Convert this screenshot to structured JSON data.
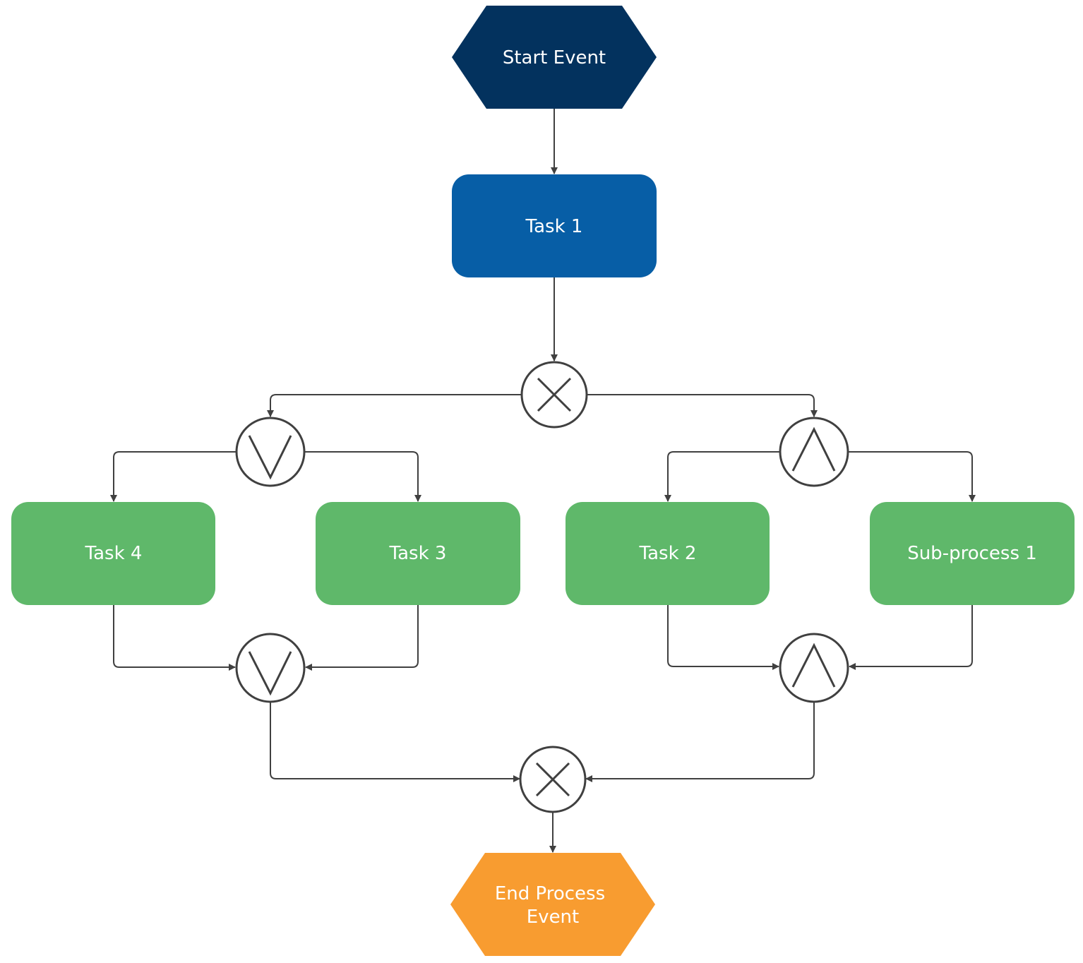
{
  "diagram": {
    "type": "process-flow",
    "colors": {
      "start_event": "#03325e",
      "task_primary": "#075ea6",
      "task_branch": "#5fb86a",
      "end_event": "#f89c30",
      "connector": "#404040"
    },
    "nodes": {
      "start": {
        "label": "Start Event",
        "shape": "hexagon"
      },
      "task1": {
        "label": "Task 1",
        "shape": "rounded-rect"
      },
      "task4": {
        "label": "Task 4",
        "shape": "rounded-rect"
      },
      "task3": {
        "label": "Task 3",
        "shape": "rounded-rect"
      },
      "task2": {
        "label": "Task 2",
        "shape": "rounded-rect"
      },
      "sub1": {
        "label": "Sub-process 1",
        "shape": "rounded-rect"
      },
      "end_line1": {
        "label": "End Process"
      },
      "end_line2": {
        "label": "Event"
      },
      "gateways": {
        "xor_split": "xor-icon",
        "or_split": "or-icon",
        "and_split": "and-icon",
        "or_join": "or-icon",
        "and_join": "and-icon",
        "xor_join": "xor-icon"
      }
    },
    "edges": [
      [
        "Start Event",
        "Task 1"
      ],
      [
        "Task 1",
        "XOR split"
      ],
      [
        "XOR split",
        "OR split"
      ],
      [
        "XOR split",
        "AND split"
      ],
      [
        "OR split",
        "Task 4"
      ],
      [
        "OR split",
        "Task 3"
      ],
      [
        "AND split",
        "Task 2"
      ],
      [
        "AND split",
        "Sub-process 1"
      ],
      [
        "Task 4",
        "OR join"
      ],
      [
        "Task 3",
        "OR join"
      ],
      [
        "Task 2",
        "AND join"
      ],
      [
        "Sub-process 1",
        "AND join"
      ],
      [
        "OR join",
        "XOR join"
      ],
      [
        "AND join",
        "XOR join"
      ],
      [
        "XOR join",
        "End Process Event"
      ]
    ]
  }
}
